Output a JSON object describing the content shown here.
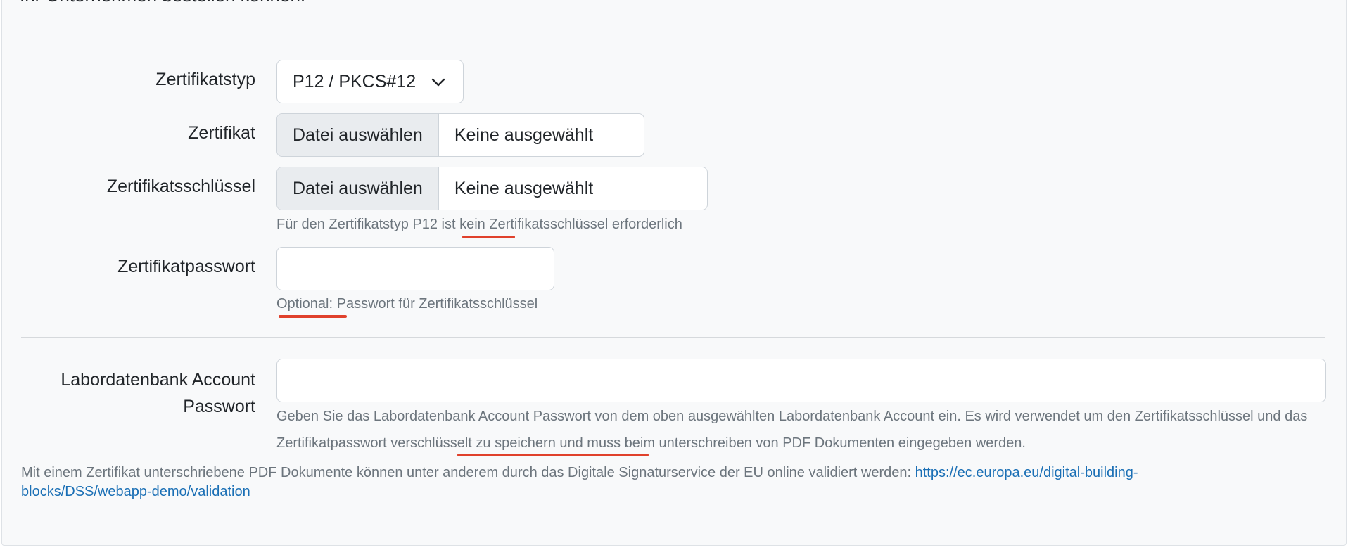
{
  "intro": {
    "cut_text": "Ihr Unternehmen bestellen können."
  },
  "form": {
    "cert_type": {
      "label": "Zertifikatstyp",
      "selected": "P12 / PKCS#12"
    },
    "certificate": {
      "label": "Zertifikat",
      "button": "Datei auswählen",
      "file_name": "Keine ausgewählt"
    },
    "cert_key": {
      "label": "Zertifikatsschlüssel",
      "button": "Datei auswählen",
      "file_name": "Keine ausgewählt",
      "help": "Für den Zertifikatstyp P12 ist kein Zertifikatsschlüssel erforderlich"
    },
    "cert_password": {
      "label": "Zertifikatpasswort",
      "value": "",
      "help": "Optional: Passwort für Zertifikatsschlüssel"
    },
    "lab_password": {
      "label": "Labordatenbank Account Passwort",
      "value": "",
      "help": "Geben Sie das Labordatenbank Account Passwort von dem oben ausgewählten Labordatenbank Account ein. Es wird verwendet um den Zertifikatsschlüssel und das Zertifikatpasswort verschlüsselt zu speichern und muss beim unterschreiben von PDF Dokumenten eingegeben werden."
    }
  },
  "footer": {
    "text": "Mit einem Zertifikat unterschriebene PDF Dokumente können unter anderem durch das Digitale Signaturservice der EU online validiert werden: ",
    "link": "https://ec.europa.eu/digital-building-blocks/DSS/webapp-demo/validation"
  },
  "colors": {
    "annotation_underline": "#e0412c",
    "link": "#1a6fb5"
  }
}
